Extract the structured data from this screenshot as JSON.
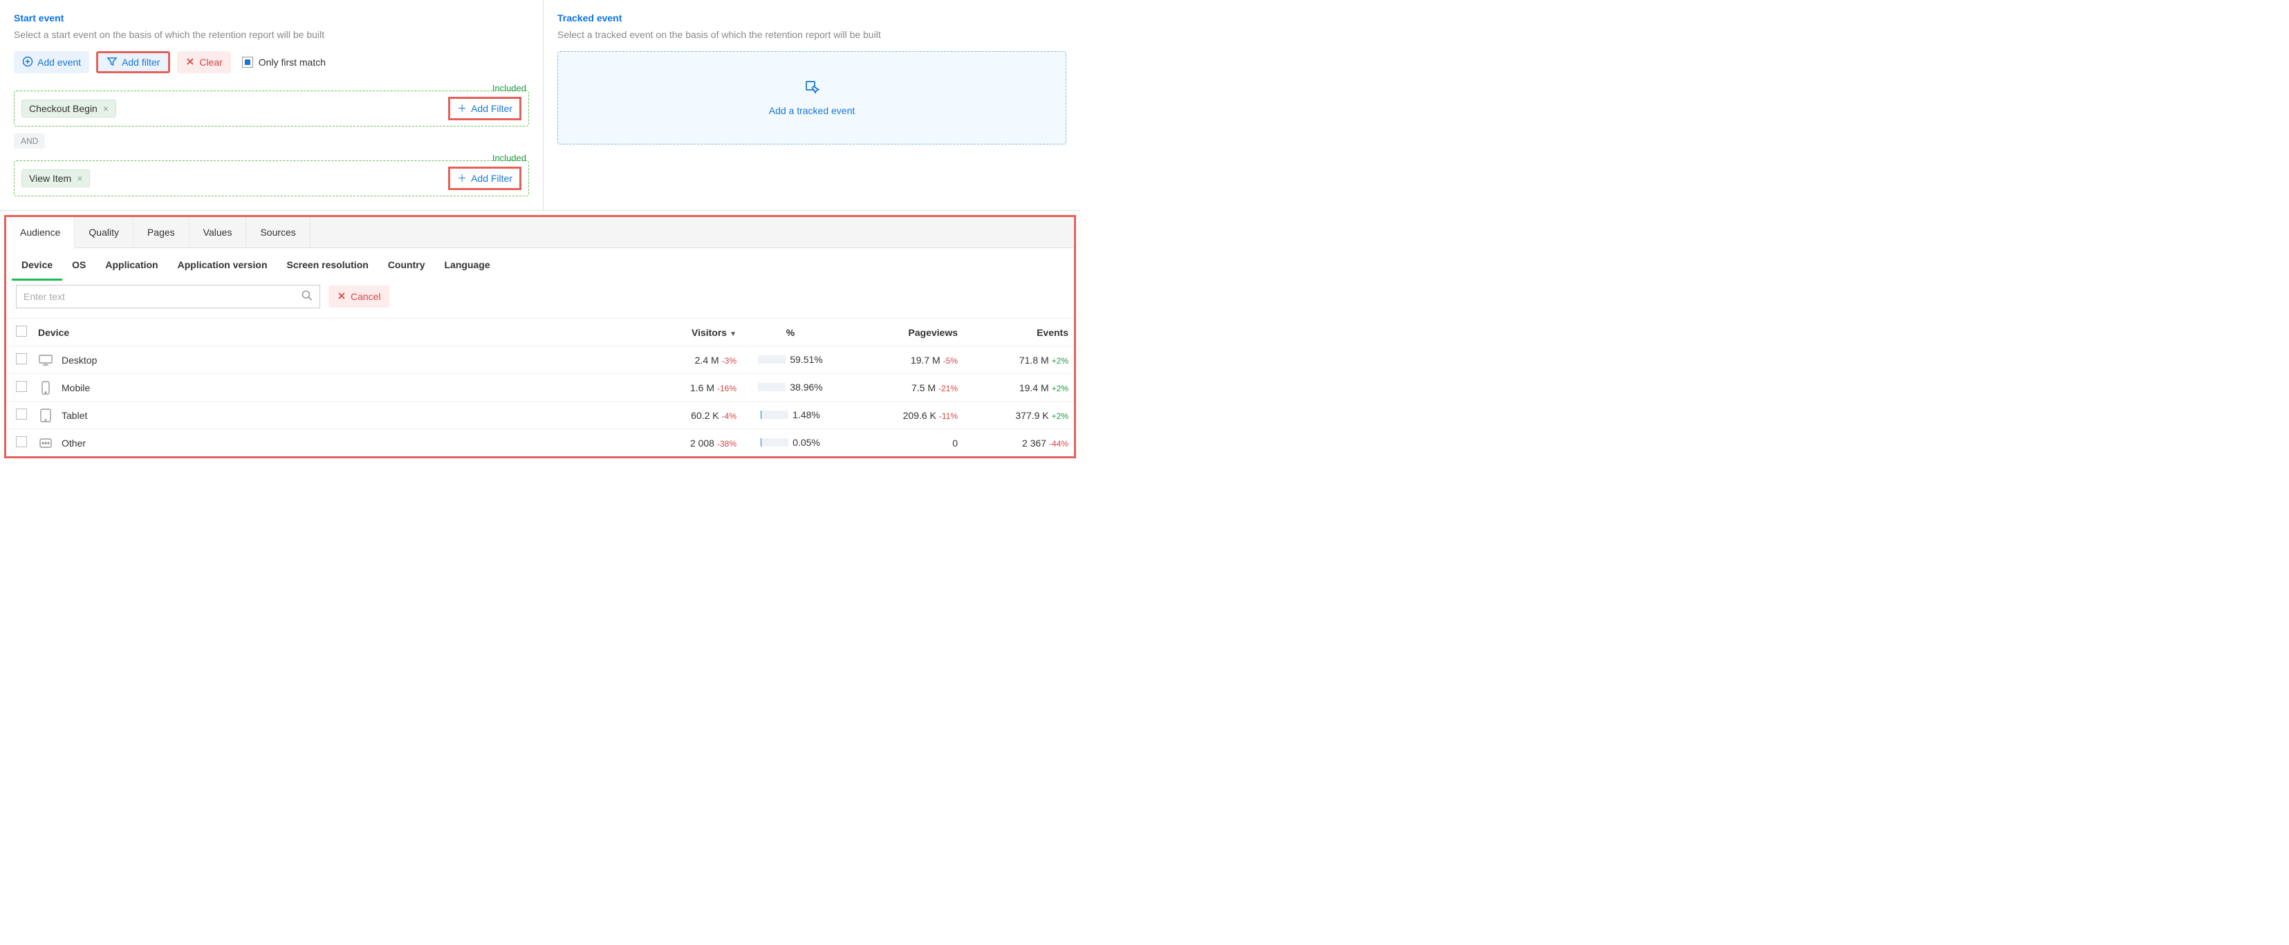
{
  "startEvent": {
    "title": "Start event",
    "desc": "Select a start event on the basis of which the retention report will be built",
    "addEvent": "Add event",
    "addFilter": "Add filter",
    "clear": "Clear",
    "onlyFirst": "Only first match",
    "includedLabel": "Included",
    "andLabel": "AND",
    "addFilterInline": "Add Filter",
    "events": [
      {
        "name": "Checkout Begin"
      },
      {
        "name": "View Item"
      }
    ]
  },
  "trackedEvent": {
    "title": "Tracked event",
    "desc": "Select a tracked event on the basis of which the retention report will be built",
    "dropText": "Add a tracked event"
  },
  "mainTabs": [
    "Audience",
    "Quality",
    "Pages",
    "Values",
    "Sources"
  ],
  "subTabs": [
    "Device",
    "OS",
    "Application",
    "Application version",
    "Screen resolution",
    "Country",
    "Language"
  ],
  "filterRow": {
    "placeholder": "Enter text",
    "cancel": "Cancel"
  },
  "table": {
    "headers": {
      "device": "Device",
      "visitors": "Visitors",
      "percent": "%",
      "pageviews": "Pageviews",
      "events": "Events"
    },
    "rows": [
      {
        "icon": "desktop",
        "device": "Desktop",
        "visitors": "2.4 M",
        "visDelta": "-3%",
        "pct": 59.51,
        "pctLabel": "59.51%",
        "pageviews": "19.7 M",
        "pvDelta": "-5%",
        "events": "71.8 M",
        "evDelta": "+2%",
        "evPos": true
      },
      {
        "icon": "mobile",
        "device": "Mobile",
        "visitors": "1.6 M",
        "visDelta": "-16%",
        "pct": 38.96,
        "pctLabel": "38.96%",
        "pageviews": "7.5 M",
        "pvDelta": "-21%",
        "events": "19.4 M",
        "evDelta": "+2%",
        "evPos": true
      },
      {
        "icon": "tablet",
        "device": "Tablet",
        "visitors": "60.2 K",
        "visDelta": "-4%",
        "pct": 1.48,
        "pctLabel": "1.48%",
        "pageviews": "209.6 K",
        "pvDelta": "-11%",
        "events": "377.9 K",
        "evDelta": "+2%",
        "evPos": true
      },
      {
        "icon": "other",
        "device": "Other",
        "visitors": "2 008",
        "visDelta": "-38%",
        "pct": 0.05,
        "pctLabel": "0.05%",
        "pageviews": "0",
        "pvDelta": "",
        "events": "2 367",
        "evDelta": "-44%",
        "evPos": false
      }
    ]
  }
}
